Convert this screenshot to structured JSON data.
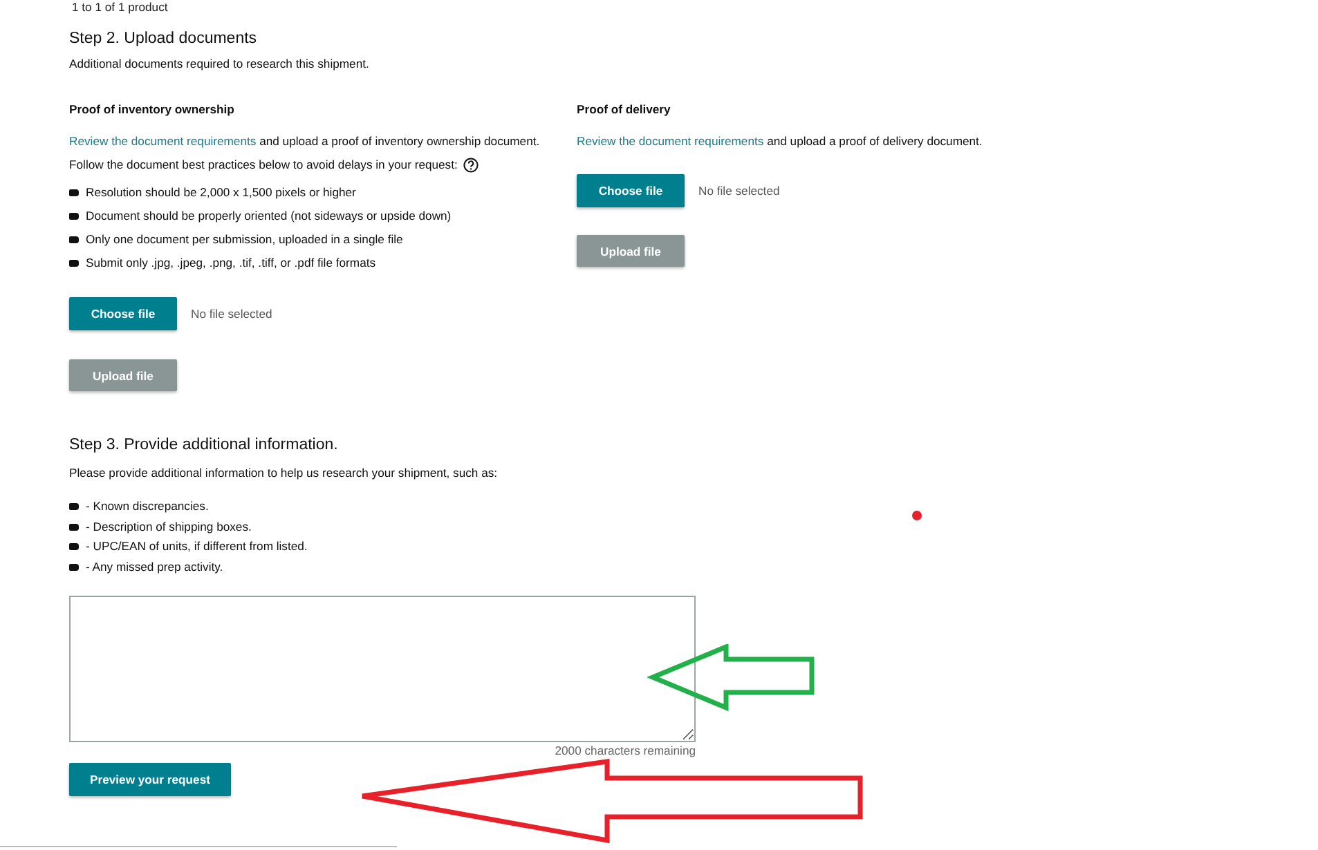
{
  "results_note": "1 to 1 of 1 product",
  "step2": {
    "title": "Step 2. Upload documents",
    "subtitle": "Additional documents required to research this shipment.",
    "sections": [
      {
        "heading": "Proof of inventory ownership",
        "link": "Review the document requirements",
        "text": "and upload a proof of inventory ownership document.",
        "practices_intro": "Follow the document best practices below to avoid delays in your request:",
        "practices": [
          "Resolution should be 2,000 x 1,500 pixels or higher",
          "Document should be properly oriented (not sideways or upside down)",
          "Only one document per submission, uploaded in a single file",
          "Submit only .jpg, .jpeg, .png, .tif, .tiff, or .pdf file formats"
        ],
        "choose_button": "Choose file",
        "file_status": "No file selected",
        "upload_button": "Upload file"
      },
      {
        "heading": "Proof of delivery",
        "link": "Review the document requirements",
        "text": "and upload a proof of delivery document.",
        "choose_button": "Choose file",
        "file_status": "No file selected",
        "upload_button": "Upload file"
      }
    ]
  },
  "step3": {
    "title": "Step 3. Provide additional information.",
    "intro": "Please provide additional information to help us research your shipment, such as:",
    "items": [
      "- Known discrepancies.",
      "- Description of shipping boxes.",
      "- UPC/EAN of units, if different from listed.",
      "- Any missed prep activity."
    ],
    "counter": "2000 characters remaining",
    "preview_button": "Preview your request"
  }
}
